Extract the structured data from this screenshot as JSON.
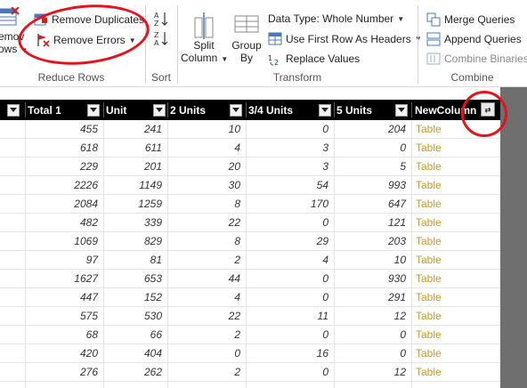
{
  "ribbon": {
    "reduce_rows": {
      "label": "Reduce Rows",
      "remove_rows_line1": "emov",
      "remove_rows_line2": "ows",
      "remove_duplicates": "Remove Duplicates",
      "remove_errors": "Remove Errors"
    },
    "sort": {
      "label": "Sort"
    },
    "transform": {
      "label": "Transform",
      "split_column_line1": "Split",
      "split_column_line2": "Column",
      "group_by_line1": "Group",
      "group_by_line2": "By",
      "data_type": "Data Type: Whole Number",
      "use_first_row": "Use First Row As Headers",
      "replace_values": "Replace Values"
    },
    "combine": {
      "label": "Combine",
      "merge_queries": "Merge Queries",
      "append_queries": "Append Queries",
      "combine_binaries": "Combine Binaries"
    }
  },
  "grid": {
    "columns": [
      "Total 1",
      "Unit",
      "2 Units",
      "3/4 Units",
      "5 Units",
      "NewColumn"
    ],
    "rows": [
      [
        "455",
        "241",
        "10",
        "0",
        "204",
        "Table"
      ],
      [
        "618",
        "611",
        "4",
        "3",
        "0",
        "Table"
      ],
      [
        "229",
        "201",
        "20",
        "3",
        "5",
        "Table"
      ],
      [
        "2226",
        "1149",
        "30",
        "54",
        "993",
        "Table"
      ],
      [
        "2084",
        "1259",
        "8",
        "170",
        "647",
        "Table"
      ],
      [
        "482",
        "339",
        "22",
        "0",
        "121",
        "Table"
      ],
      [
        "1069",
        "829",
        "8",
        "29",
        "203",
        "Table"
      ],
      [
        "97",
        "81",
        "2",
        "4",
        "10",
        "Table"
      ],
      [
        "1627",
        "653",
        "44",
        "0",
        "930",
        "Table"
      ],
      [
        "447",
        "152",
        "4",
        "0",
        "291",
        "Table"
      ],
      [
        "575",
        "530",
        "22",
        "11",
        "12",
        "Table"
      ],
      [
        "68",
        "66",
        "2",
        "0",
        "0",
        "Table"
      ],
      [
        "420",
        "404",
        "0",
        "16",
        "0",
        "Table"
      ],
      [
        "276",
        "262",
        "2",
        "0",
        "12",
        "Table"
      ],
      [
        "",
        "",
        "",
        "",
        "",
        ""
      ]
    ],
    "link_color": "#c59a2e",
    "header_bg": "#000000",
    "annotation_color": "#e8101a"
  }
}
